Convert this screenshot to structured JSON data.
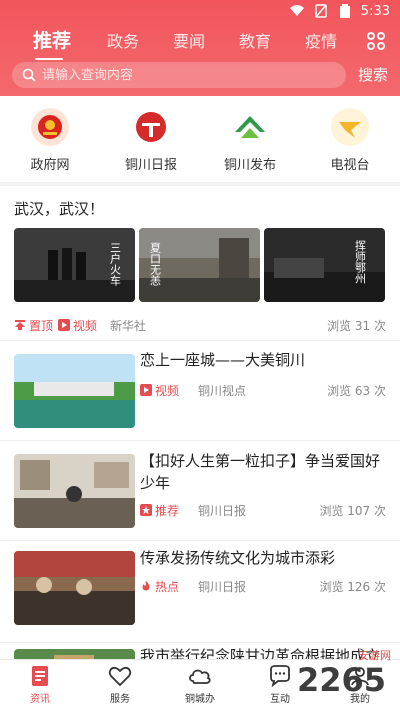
{
  "status_bar": {
    "time": "5:33"
  },
  "header": {
    "tabs": [
      {
        "label": "推荐",
        "active": true
      },
      {
        "label": "政务",
        "active": false
      },
      {
        "label": "要闻",
        "active": false
      },
      {
        "label": "教育",
        "active": false
      },
      {
        "label": "疫情",
        "active": false
      }
    ],
    "search": {
      "placeholder": "请输入查询内容",
      "button_label": "搜索"
    }
  },
  "quick_links": [
    {
      "label": "政府网",
      "icon": "national-emblem-icon"
    },
    {
      "label": "铜川日报",
      "icon": "tongchuan-daily-logo-icon"
    },
    {
      "label": "铜川发布",
      "icon": "tongchuan-release-logo-icon"
    },
    {
      "label": "电视台",
      "icon": "tv-station-logo-icon"
    }
  ],
  "feature": {
    "title": "武汉，武汉！",
    "images": [
      {
        "caption": "三户火车",
        "icon": "video-still-icon"
      },
      {
        "caption": "夏口无恙",
        "icon": "video-still-icon"
      },
      {
        "caption": "挥师鄂州",
        "icon": "video-still-icon"
      }
    ],
    "tags": [
      "置顶",
      "视频"
    ],
    "source": "新华社",
    "views": "浏览 31 次"
  },
  "articles": [
    {
      "title": "恋上一座城——大美铜川",
      "tag": "视频",
      "source": "铜川视点",
      "views": "浏览 63 次"
    },
    {
      "title": "【扣好人生第一粒扣子】争当爱国好少年",
      "tag": "推荐",
      "source": "铜川日报",
      "views": "浏览 107 次"
    },
    {
      "title": "传承发扬传统文化为城市添彩",
      "tag": "热点",
      "source": "铜川日报",
      "views": "浏览 126 次"
    },
    {
      "title": "我市举行纪念陕甘边革命根据地成立",
      "tag": "",
      "source": "",
      "views": ""
    }
  ],
  "bottom_nav": [
    {
      "label": "资讯",
      "active": true
    },
    {
      "label": "服务",
      "active": false
    },
    {
      "label": "铜城办",
      "active": false
    },
    {
      "label": "互动",
      "active": false
    },
    {
      "label": "我的",
      "active": false
    }
  ],
  "watermark": {
    "text": "2265",
    "sub": "安游网"
  },
  "colors": {
    "brand_red": "#f2555c",
    "tag_red": "#e94c4f",
    "text": "#222222",
    "muted": "#888888"
  }
}
